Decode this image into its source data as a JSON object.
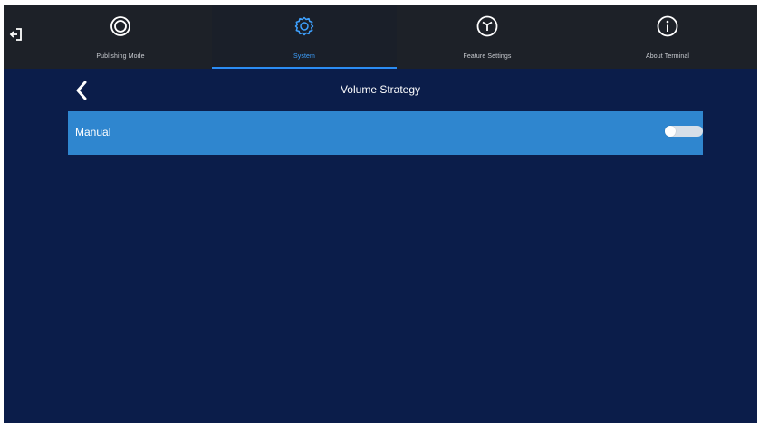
{
  "nav": {
    "exit_icon": "exit-icon",
    "tabs": [
      {
        "label": "Publishing Mode",
        "icon": "publishing-mode-icon",
        "active": false
      },
      {
        "label": "System",
        "icon": "gear-icon",
        "active": true
      },
      {
        "label": "Feature Settings",
        "icon": "feature-settings-icon",
        "active": false
      },
      {
        "label": "About Terminal",
        "icon": "info-icon",
        "active": false
      }
    ]
  },
  "page": {
    "title": "Volume Strategy",
    "back_icon": "chevron-left-icon"
  },
  "settings": {
    "manual": {
      "label": "Manual",
      "enabled": false
    }
  },
  "colors": {
    "background": "#0b1d4a",
    "top_bar": "#1d2128",
    "accent": "#2b8cf3",
    "row_highlight": "#2f86cf"
  }
}
